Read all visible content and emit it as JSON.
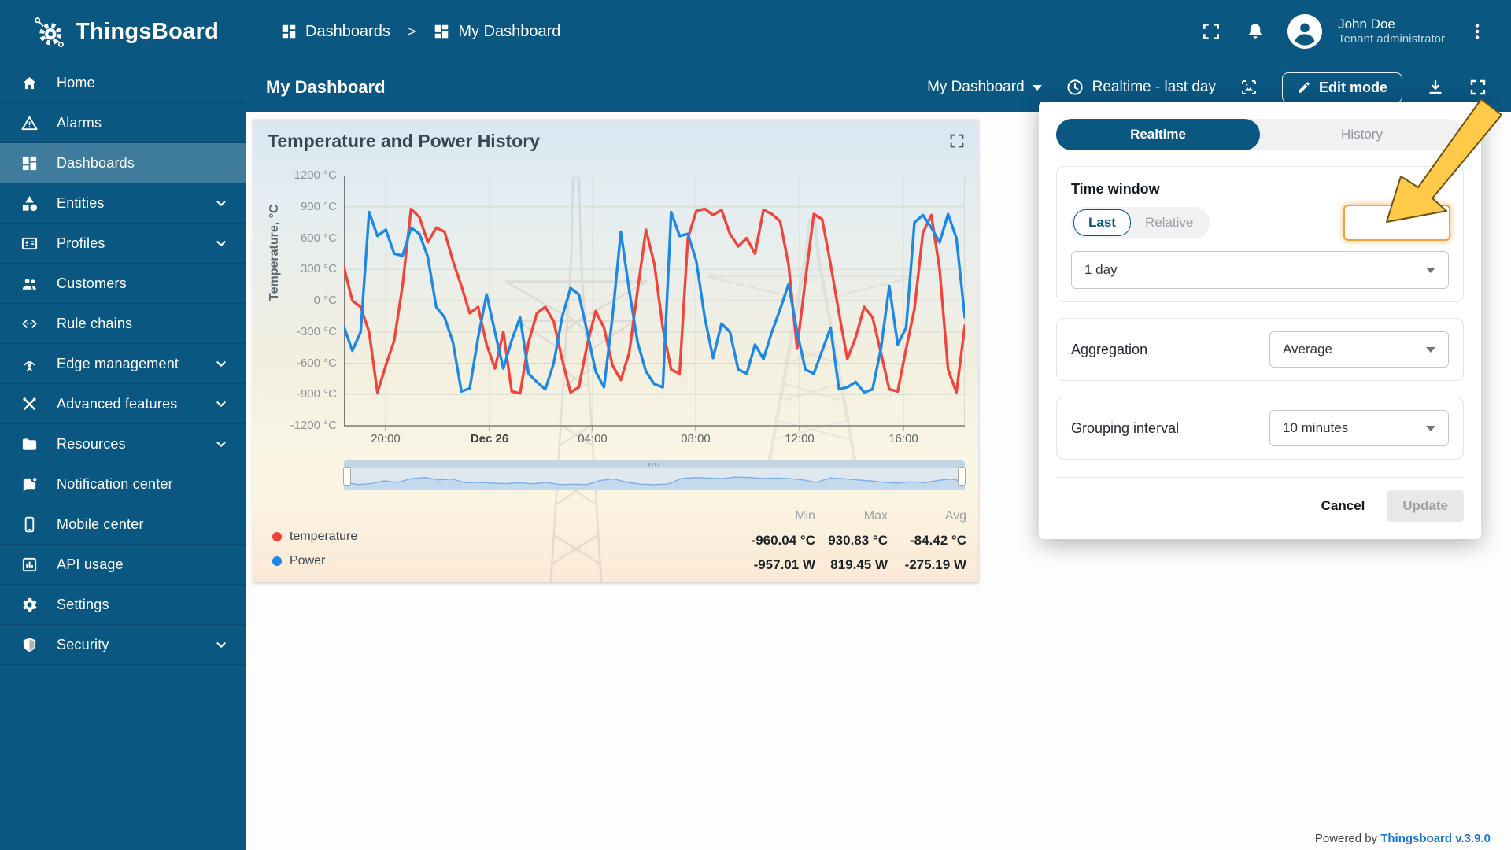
{
  "header": {
    "app_name": "ThingsBoard",
    "breadcrumb": {
      "root": "Dashboards",
      "separator": ">",
      "current": "My Dashboard"
    },
    "user": {
      "name": "John Doe",
      "role": "Tenant administrator"
    }
  },
  "sidebar": {
    "items": [
      {
        "label": "Home",
        "icon": "home",
        "selected": false,
        "expandable": false
      },
      {
        "label": "Alarms",
        "icon": "alarms",
        "selected": false,
        "expandable": false
      },
      {
        "label": "Dashboards",
        "icon": "dashboards",
        "selected": true,
        "expandable": false
      },
      {
        "label": "Entities",
        "icon": "entities",
        "selected": false,
        "expandable": true
      },
      {
        "label": "Profiles",
        "icon": "profiles",
        "selected": false,
        "expandable": true
      },
      {
        "label": "Customers",
        "icon": "customers",
        "selected": false,
        "expandable": false
      },
      {
        "label": "Rule chains",
        "icon": "rule-chains",
        "selected": false,
        "expandable": false
      },
      {
        "label": "Edge management",
        "icon": "edge-management",
        "selected": false,
        "expandable": true
      },
      {
        "label": "Advanced features",
        "icon": "advanced-features",
        "selected": false,
        "expandable": true
      },
      {
        "label": "Resources",
        "icon": "resources",
        "selected": false,
        "expandable": true
      },
      {
        "label": "Notification center",
        "icon": "notification-center",
        "selected": false,
        "expandable": false
      },
      {
        "label": "Mobile center",
        "icon": "mobile-center",
        "selected": false,
        "expandable": false
      },
      {
        "label": "API usage",
        "icon": "api-usage",
        "selected": false,
        "expandable": false
      },
      {
        "label": "Settings",
        "icon": "settings",
        "selected": false,
        "expandable": false
      },
      {
        "label": "Security",
        "icon": "security",
        "selected": false,
        "expandable": true
      }
    ]
  },
  "toolbar": {
    "title": "My Dashboard",
    "dashboard_select": "My Dashboard",
    "time_range": "Realtime - last day",
    "edit_mode": "Edit mode"
  },
  "widget": {
    "title": "Temperature and Power History"
  },
  "chart_data": {
    "type": "line",
    "title": "Temperature and Power History",
    "xlabel": "",
    "ylabel": "Temperature, °C",
    "ylim": [
      -1200,
      1200
    ],
    "y_tick_step": 300,
    "yticks": [
      "1200 °C",
      "900 °C",
      "600 °C",
      "300 °C",
      "0 °C",
      "-300 °C",
      "-600 °C",
      "-900 °C",
      "-1200 °C"
    ],
    "xticks": [
      "20:00",
      "Dec 26",
      "04:00",
      "08:00",
      "12:00",
      "16:00"
    ],
    "x_emphasis": "Dec 26",
    "grid": true,
    "legend_position": "bottom-left",
    "stats_headers": [
      "Min",
      "Max",
      "Avg"
    ],
    "series": [
      {
        "name": "temperature",
        "unit": "°C",
        "color": "#f0453c",
        "stats": {
          "min": "-960.04 °C",
          "max": "930.83 °C",
          "avg": "-84.42 °C"
        },
        "values": [
          320,
          0,
          -60,
          -300,
          -880,
          -620,
          -380,
          150,
          880,
          800,
          560,
          700,
          660,
          380,
          140,
          -120,
          -60,
          -420,
          -650,
          -300,
          -870,
          -890,
          -400,
          -120,
          -60,
          -200,
          -560,
          -880,
          -830,
          -420,
          -100,
          -260,
          -620,
          -760,
          -500,
          100,
          680,
          350,
          -260,
          -660,
          -700,
          600,
          860,
          880,
          820,
          870,
          640,
          520,
          600,
          450,
          870,
          830,
          760,
          340,
          -460,
          200,
          830,
          780,
          350,
          -120,
          -560,
          -350,
          -60,
          -160,
          -500,
          -850,
          -870,
          -460,
          -80,
          650,
          820,
          300,
          -660,
          -880,
          -240
        ]
      },
      {
        "name": "Power",
        "unit": "W",
        "color": "#1e88e5",
        "stats": {
          "min": "-957.01 W",
          "max": "819.45 W",
          "avg": "-275.19 W"
        },
        "values": [
          -250,
          -480,
          -300,
          850,
          620,
          680,
          450,
          430,
          700,
          640,
          420,
          -60,
          -160,
          -400,
          -870,
          -840,
          -350,
          60,
          -300,
          -650,
          -380,
          -160,
          -700,
          -780,
          -850,
          -600,
          -160,
          120,
          60,
          -300,
          -680,
          -830,
          -160,
          660,
          100,
          -400,
          -680,
          -800,
          -830,
          850,
          620,
          640,
          380,
          -160,
          -550,
          -220,
          -300,
          -660,
          -700,
          -420,
          -560,
          -300,
          -80,
          160,
          -300,
          -660,
          -700,
          -480,
          -260,
          -850,
          -830,
          -780,
          -880,
          -850,
          -460,
          140,
          -420,
          -260,
          750,
          820,
          700,
          560,
          830,
          600,
          -160
        ]
      }
    ],
    "navigator": {
      "values": [
        0.45,
        0.3,
        0.35,
        0.5,
        0.42,
        0.62,
        0.68,
        0.55,
        0.6,
        0.4,
        0.42,
        0.38,
        0.35,
        0.4,
        0.34,
        0.42,
        0.3,
        0.32,
        0.3,
        0.52,
        0.6,
        0.42,
        0.32,
        0.3,
        0.33,
        0.62,
        0.68,
        0.65,
        0.62,
        0.7,
        0.68,
        0.63,
        0.65,
        0.62,
        0.55,
        0.42,
        0.65,
        0.62,
        0.55,
        0.5,
        0.42,
        0.38,
        0.45,
        0.4,
        0.52,
        0.6,
        0.45
      ]
    }
  },
  "popup": {
    "tabs": [
      "Realtime",
      "History"
    ],
    "active_tab": "Realtime",
    "time_window": {
      "label": "Time window",
      "modes": [
        "Last",
        "Relative"
      ],
      "selected_mode": "Last",
      "interval": "1 day"
    },
    "aggregation": {
      "label": "Aggregation",
      "value": "Average"
    },
    "grouping": {
      "label": "Grouping interval",
      "value": "10 minutes"
    },
    "cancel": "Cancel",
    "update": "Update"
  },
  "footer": {
    "powered_by": "Powered by ",
    "brand": "Thingsboard v.3.9.0"
  },
  "colors": {
    "primary": "#0a5782",
    "accent_orange": "#f2a33c",
    "arrow_yellow": "#ffc94a",
    "temperature": "#f0453c",
    "power": "#1e88e5",
    "link": "#1976d2"
  }
}
